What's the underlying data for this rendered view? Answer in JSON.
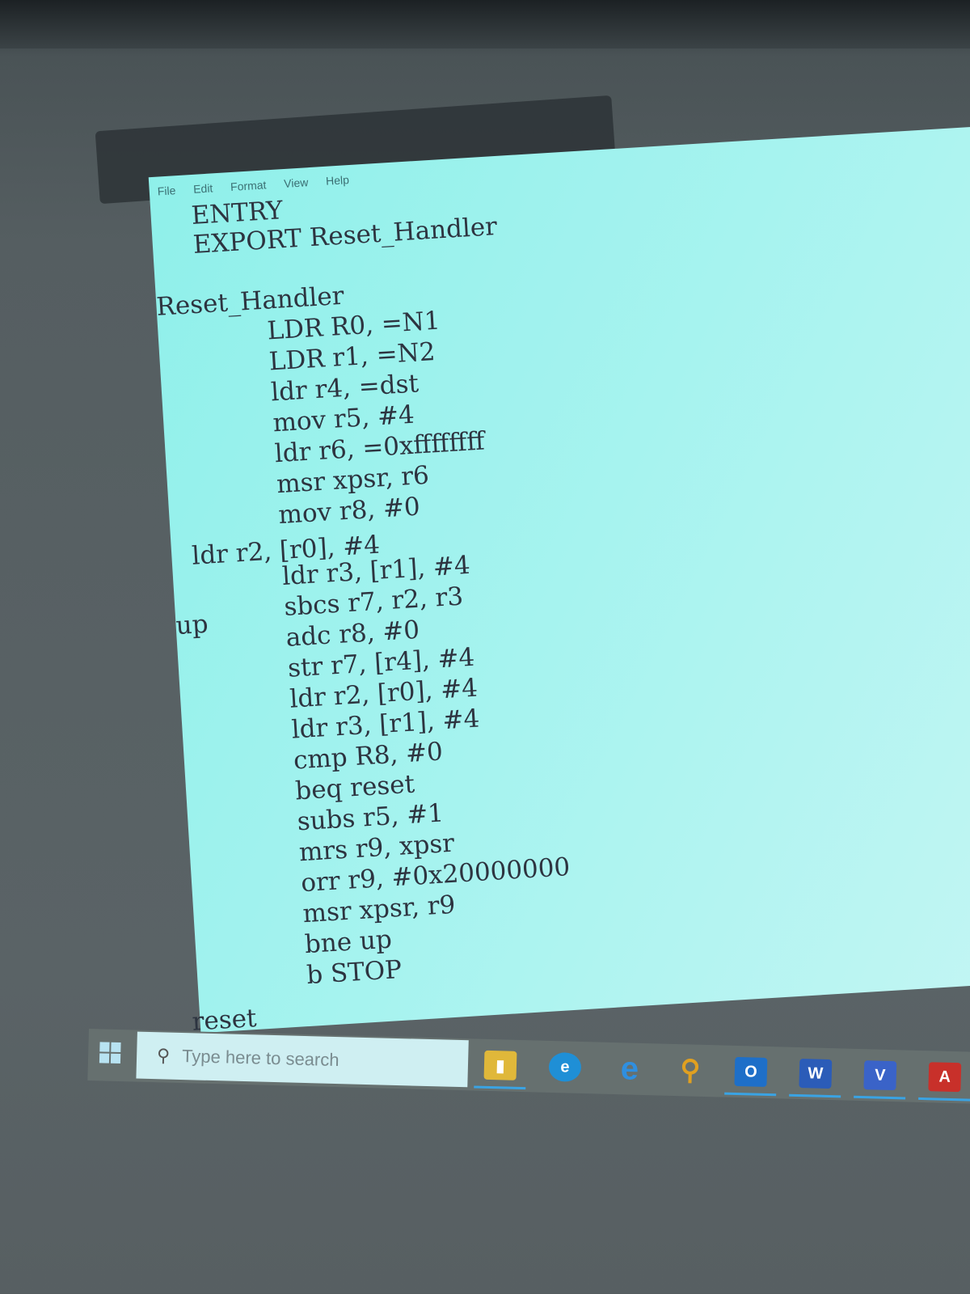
{
  "menu": [
    "File",
    "Edit",
    "Format",
    "View",
    "Help"
  ],
  "code_lines": [
    "ENTRY",
    "EXPORT Reset_Handler",
    "",
    "Reset_Handler",
    "LDR R0, =N1",
    "LDR r1, =N2",
    "ldr r4, =dst",
    "mov r5, #4",
    "ldr r6, =0xffffffff",
    "msr xpsr, r6",
    "mov r8, #0",
    "ldr r2, [r0], #4",
    "ldr r3, [r1], #4",
    "sbcs r7, r2, r3",
    "adc r8, #0",
    "str r7, [r4], #4",
    "ldr r2, [r0], #4",
    "ldr r3, [r1], #4",
    "cmp R8, #0",
    "beq reset",
    "subs r5, #1",
    "mrs r9, xpsr",
    "orr r9, #0x20000000",
    "msr xpsr, r9",
    "bne up",
    "b STOP"
  ],
  "labels": {
    "up": "up",
    "reset": "reset"
  },
  "taskbar": {
    "search_placeholder": "Type here to search",
    "icons": [
      "file-explorer-icon",
      "edge-icon",
      "internet-explorer-icon",
      "search-app-icon",
      "outlook-icon",
      "word-icon",
      "visio-icon",
      "acrobat-icon"
    ]
  },
  "colors": {
    "editor_bg": "#a6f3ef",
    "text": "#2d3440",
    "taskbar": "#66706f"
  }
}
